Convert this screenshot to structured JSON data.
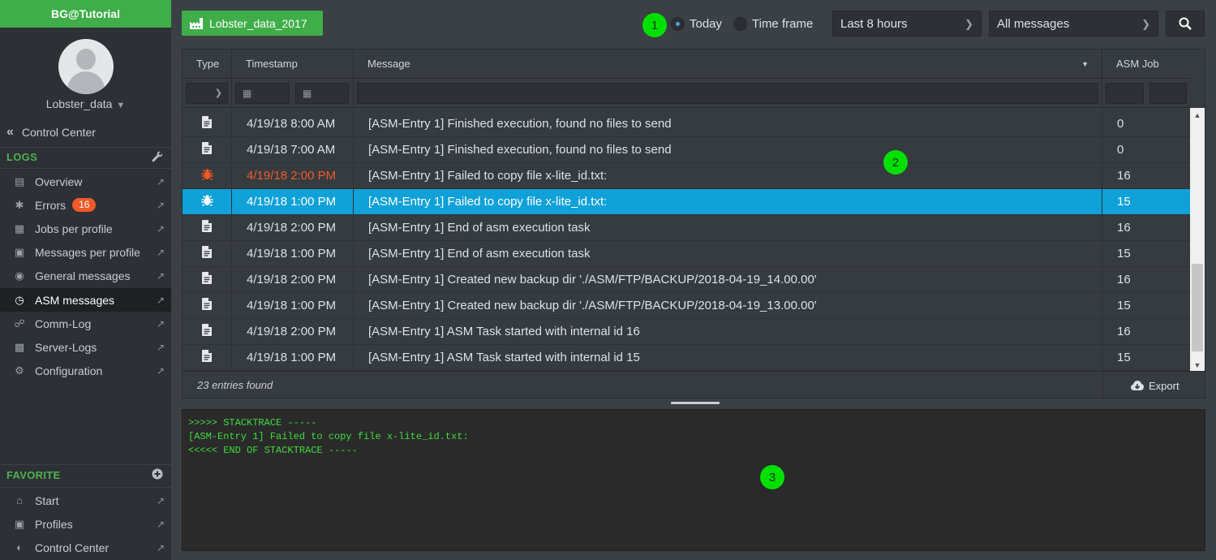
{
  "sidebar": {
    "title": "BG@Tutorial",
    "user": "Lobster_data",
    "back_link": "Control Center",
    "logs_title": "LOGS",
    "logs_items": [
      {
        "label": "Overview",
        "icon": "document-icon"
      },
      {
        "label": "Errors",
        "icon": "bug-icon",
        "badge": "16"
      },
      {
        "label": "Jobs per profile",
        "icon": "chart-icon"
      },
      {
        "label": "Messages per profile",
        "icon": "chip-icon"
      },
      {
        "label": "General messages",
        "icon": "globe-icon"
      },
      {
        "label": "ASM messages",
        "icon": "clock-icon",
        "active": true
      },
      {
        "label": "Comm-Log",
        "icon": "network-icon"
      },
      {
        "label": "Server-Logs",
        "icon": "file-icon"
      },
      {
        "label": "Configuration",
        "icon": "gears-icon"
      }
    ],
    "favorite_title": "FAVORITE",
    "favorite_items": [
      {
        "label": "Start",
        "icon": "home-icon"
      },
      {
        "label": "Profiles",
        "icon": "chip-icon"
      },
      {
        "label": "Control Center",
        "icon": "dashboard-icon"
      }
    ]
  },
  "toolbar": {
    "profile_button": "Lobster_data_2017",
    "radio_today": "Today",
    "radio_timeframe": "Time frame",
    "selected_radio": "Today",
    "range_select": "Last 8 hours",
    "type_select": "All messages",
    "markers": [
      "1",
      "2",
      "3"
    ]
  },
  "table": {
    "headers": {
      "type": "Type",
      "timestamp": "Timestamp",
      "message": "Message",
      "asm_job": "ASM Job"
    },
    "rows": [
      {
        "icon": "document-icon",
        "timestamp": "4/19/18 8:00 AM",
        "message": "[ASM-Entry 1] Finished execution, found no files to send",
        "asm_job": "0",
        "state": "normal"
      },
      {
        "icon": "document-icon",
        "timestamp": "4/19/18 7:00 AM",
        "message": "[ASM-Entry 1] Finished execution, found no files to send",
        "asm_job": "0",
        "state": "normal"
      },
      {
        "icon": "bug-icon",
        "timestamp": "4/19/18 2:00 PM",
        "message": "[ASM-Entry 1] Failed to copy file x-lite_id.txt:",
        "asm_job": "16",
        "state": "error"
      },
      {
        "icon": "bug-icon",
        "timestamp": "4/19/18 1:00 PM",
        "message": "[ASM-Entry 1] Failed to copy file x-lite_id.txt:",
        "asm_job": "15",
        "state": "selected"
      },
      {
        "icon": "document-icon",
        "timestamp": "4/19/18 2:00 PM",
        "message": "[ASM-Entry 1] End of asm execution task",
        "asm_job": "16",
        "state": "normal"
      },
      {
        "icon": "document-icon",
        "timestamp": "4/19/18 1:00 PM",
        "message": "[ASM-Entry 1] End of asm execution task",
        "asm_job": "15",
        "state": "normal"
      },
      {
        "icon": "document-icon",
        "timestamp": "4/19/18 2:00 PM",
        "message": "[ASM-Entry 1] Created new backup dir './ASM/FTP/BACKUP/2018-04-19_14.00.00'",
        "asm_job": "16",
        "state": "normal"
      },
      {
        "icon": "document-icon",
        "timestamp": "4/19/18 1:00 PM",
        "message": "[ASM-Entry 1] Created new backup dir './ASM/FTP/BACKUP/2018-04-19_13.00.00'",
        "asm_job": "15",
        "state": "normal"
      },
      {
        "icon": "document-icon",
        "timestamp": "4/19/18 2:00 PM",
        "message": "[ASM-Entry 1] ASM Task started with internal id 16",
        "asm_job": "16",
        "state": "normal"
      },
      {
        "icon": "document-icon",
        "timestamp": "4/19/18 1:00 PM",
        "message": "[ASM-Entry 1] ASM Task started with internal id 15",
        "asm_job": "15",
        "state": "normal"
      }
    ],
    "entries_found": "23 entries found",
    "export_label": "Export"
  },
  "stacktrace": {
    "lines": [
      ">>>>> STACKTRACE -----",
      "[ASM-Entry 1] Failed to copy file x-lite_id.txt:",
      "<<<<< END OF STACKTRACE -----"
    ]
  },
  "colors": {
    "accent_green": "#3fae49",
    "error_red": "#f05a28",
    "selection_blue": "#0fa1d8",
    "trace_text": "#3fdc3f",
    "marker": "#00e000"
  }
}
